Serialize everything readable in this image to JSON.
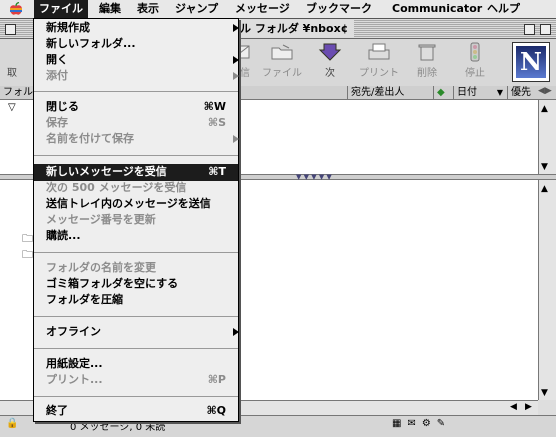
{
  "menubar": {
    "items": [
      "ファイル",
      "編集",
      "表示",
      "ジャンプ",
      "メッセージ",
      "ブックマーク",
      "Communicator",
      "ヘルプ"
    ]
  },
  "window": {
    "title": "ル フォルダ ¥nbox¢"
  },
  "toolbar": {
    "items": [
      {
        "label": "取"
      },
      {
        "label": "返信"
      },
      {
        "label": "ファイル"
      },
      {
        "label": "次"
      },
      {
        "label": "プリント"
      },
      {
        "label": "削除"
      },
      {
        "label": "停止"
      }
    ]
  },
  "columns": {
    "folder": "フォル",
    "sender": "宛先/差出人",
    "date": "日付",
    "priority": "優先"
  },
  "status": {
    "text": "0 メッセージ, 0 未読"
  },
  "file_menu": {
    "items": [
      {
        "label": "新規作成",
        "shortcut": "",
        "submenu": true,
        "enabled": true
      },
      {
        "label": "新しいフォルダ...",
        "shortcut": "",
        "submenu": false,
        "enabled": true
      },
      {
        "label": "開く",
        "shortcut": "",
        "submenu": true,
        "enabled": true
      },
      {
        "label": "添付",
        "shortcut": "",
        "submenu": true,
        "enabled": false
      },
      {
        "label": "閉じる",
        "shortcut": "⌘W",
        "submenu": false,
        "enabled": true
      },
      {
        "label": "保存",
        "shortcut": "⌘S",
        "submenu": false,
        "enabled": false
      },
      {
        "label": "名前を付けて保存",
        "shortcut": "",
        "submenu": true,
        "enabled": false
      },
      {
        "label": "新しいメッセージを受信",
        "shortcut": "⌘T",
        "submenu": false,
        "enabled": true,
        "highlighted": true
      },
      {
        "label": "次の 500 メッセージを受信",
        "shortcut": "",
        "submenu": false,
        "enabled": false
      },
      {
        "label": "送信トレイ内のメッセージを送信",
        "shortcut": "",
        "submenu": false,
        "enabled": true
      },
      {
        "label": "メッセージ番号を更新",
        "shortcut": "",
        "submenu": false,
        "enabled": false
      },
      {
        "label": "購読...",
        "shortcut": "",
        "submenu": false,
        "enabled": true
      },
      {
        "label": "フォルダの名前を変更",
        "shortcut": "",
        "submenu": false,
        "enabled": false
      },
      {
        "label": "ゴミ箱フォルダを空にする",
        "shortcut": "",
        "submenu": false,
        "enabled": true
      },
      {
        "label": "フォルダを圧縮",
        "shortcut": "",
        "submenu": false,
        "enabled": true
      },
      {
        "label": "オフライン",
        "shortcut": "",
        "submenu": true,
        "enabled": true
      },
      {
        "label": "用紙設定...",
        "shortcut": "",
        "submenu": false,
        "enabled": true
      },
      {
        "label": "プリント...",
        "shortcut": "⌘P",
        "submenu": false,
        "enabled": false
      },
      {
        "label": "終了",
        "shortcut": "⌘Q",
        "submenu": false,
        "enabled": true
      }
    ]
  }
}
